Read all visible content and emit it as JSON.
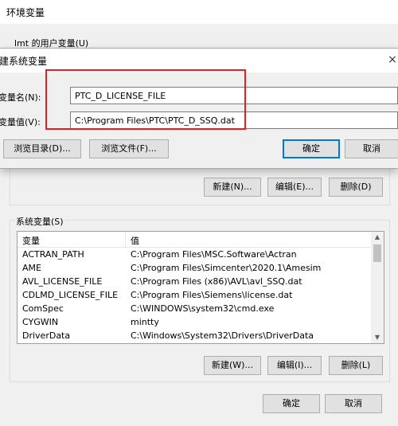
{
  "env_window": {
    "title": "环境变量",
    "user_vars_label": "lmt 的用户变量(U)",
    "user_buttons": {
      "new": "新建(N)...",
      "edit": "编辑(E)...",
      "delete": "删除(D)"
    },
    "system_vars_label": "系统变量(S)",
    "system_table": {
      "columns": [
        "变量",
        "值"
      ],
      "rows": [
        {
          "name": "ACTRAN_PATH",
          "value": "C:\\Program Files\\MSC.Software\\Actran"
        },
        {
          "name": "AME",
          "value": "C:\\Program Files\\Simcenter\\2020.1\\Amesim"
        },
        {
          "name": "AVL_LICENSE_FILE",
          "value": "C:\\Program Files (x86)\\AVL\\avl_SSQ.dat"
        },
        {
          "name": "CDLMD_LICENSE_FILE",
          "value": "C:\\Program Files\\Siemens\\license.dat"
        },
        {
          "name": "ComSpec",
          "value": "C:\\WINDOWS\\system32\\cmd.exe"
        },
        {
          "name": "CYGWIN",
          "value": "mintty"
        },
        {
          "name": "DriverData",
          "value": "C:\\Windows\\System32\\Drivers\\DriverData"
        }
      ]
    },
    "system_buttons": {
      "new": "新建(W)...",
      "edit": "编辑(I)...",
      "delete": "删除(L)"
    },
    "footer_buttons": {
      "ok": "确定",
      "cancel": "取消"
    }
  },
  "dialog": {
    "title": "建系统变量",
    "close_glyph": "×",
    "name_label": "变量名(N):",
    "name_value": "PTC_D_LICENSE_FILE",
    "value_label": "变量值(V):",
    "value_value": "C:\\Program Files\\PTC\\PTC_D_SSQ.dat",
    "browse_dir": "浏览目录(D)...",
    "browse_file": "浏览文件(F)...",
    "ok": "确定",
    "cancel": "取消"
  },
  "icons": {
    "scroll_up": "▲",
    "scroll_down": "▼"
  },
  "colors": {
    "highlight": "#e02020",
    "accent": "#0078d7"
  }
}
